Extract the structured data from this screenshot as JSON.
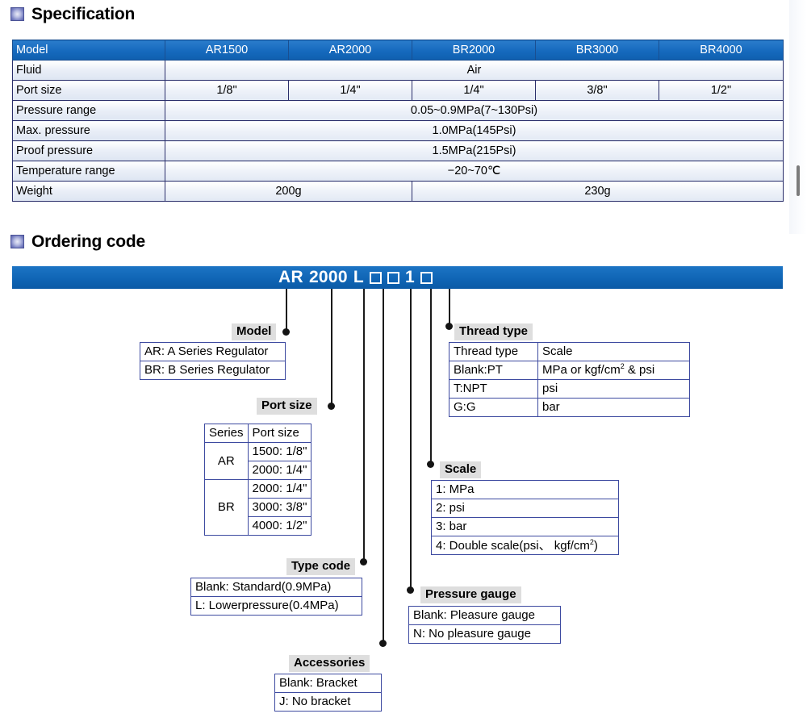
{
  "sections": {
    "specification": {
      "title": "Specification",
      "icon": "square-bullet-icon"
    },
    "ordering": {
      "title": "Ordering code",
      "icon": "square-bullet-icon"
    }
  },
  "spec_table": {
    "header": [
      "Model",
      "AR1500",
      "AR2000",
      "BR2000",
      "BR3000",
      "BR4000"
    ],
    "rows": [
      {
        "label": "Fluid",
        "cells": [
          {
            "text": "Air",
            "span": 5
          }
        ]
      },
      {
        "label": "Port size",
        "cells": [
          {
            "text": "1/8\"",
            "span": 1
          },
          {
            "text": "1/4\"",
            "span": 1
          },
          {
            "text": "1/4\"",
            "span": 1
          },
          {
            "text": "3/8\"",
            "span": 1
          },
          {
            "text": "1/2\"",
            "span": 1
          }
        ]
      },
      {
        "label": "Pressure range",
        "cells": [
          {
            "text": "0.05~0.9MPa(7~130Psi)",
            "span": 5
          }
        ]
      },
      {
        "label": "Max. pressure",
        "cells": [
          {
            "text": "1.0MPa(145Psi)",
            "span": 5
          }
        ]
      },
      {
        "label": "Proof pressure",
        "cells": [
          {
            "text": "1.5MPa(215Psi)",
            "span": 5
          }
        ]
      },
      {
        "label": "Temperature range",
        "cells": [
          {
            "text": "−20~70℃",
            "span": 5
          }
        ]
      },
      {
        "label": "Weight",
        "cells": [
          {
            "text": "200g",
            "span": 2
          },
          {
            "text": "230g",
            "span": 3
          }
        ]
      }
    ]
  },
  "ordering_code": {
    "parts": [
      "AR",
      "2000",
      "L"
    ],
    "box1": "",
    "box2": "",
    "digit": "1",
    "box3": ""
  },
  "callouts": {
    "model": {
      "label": "Model",
      "rows": [
        "AR: A Series Regulator",
        "BR: B Series Regulator"
      ]
    },
    "port_size": {
      "label": "Port size",
      "header": [
        "Series",
        "Port size"
      ],
      "groups": [
        {
          "series": "AR",
          "sizes": [
            "1500: 1/8\"",
            "2000: 1/4\""
          ]
        },
        {
          "series": "BR",
          "sizes": [
            "2000: 1/4\"",
            "3000: 3/8\"",
            "4000: 1/2\""
          ]
        }
      ]
    },
    "type_code": {
      "label": "Type code",
      "rows": [
        "Blank: Standard(0.9MPa)",
        "L: Lowerpressure(0.4MPa)"
      ]
    },
    "accessories": {
      "label": "Accessories",
      "rows": [
        "Blank: Bracket",
        "J: No bracket"
      ]
    },
    "thread_type": {
      "label": "Thread type",
      "header": [
        "Thread type",
        "Scale"
      ],
      "rows": [
        {
          "type": "Blank:PT",
          "scale_pre": "MPa or  kgf/cm",
          "scale_sup": "2",
          "scale_post": " & psi"
        },
        {
          "type": "T:NPT",
          "scale_pre": "psi",
          "scale_sup": "",
          "scale_post": ""
        },
        {
          "type": "G:G",
          "scale_pre": "bar",
          "scale_sup": "",
          "scale_post": ""
        }
      ]
    },
    "scale": {
      "label": "Scale",
      "rows": [
        {
          "pre": "1: MPa",
          "sup": "",
          "post": ""
        },
        {
          "pre": "2: psi",
          "sup": "",
          "post": ""
        },
        {
          "pre": "3: bar",
          "sup": "",
          "post": ""
        },
        {
          "pre": "4: Double scale(psi、 kgf/cm",
          "sup": "2",
          "post": ")"
        }
      ]
    },
    "pressure_gauge": {
      "label": "Pressure gauge",
      "rows": [
        "Blank: Pleasure gauge",
        "N: No pleasure gauge"
      ]
    }
  },
  "colors": {
    "header_blue": "#1569bd",
    "banner_blue": "#0f64b4",
    "border_navy": "#2b2f6b",
    "callout_border": "#3d4aa0",
    "label_bg": "#dedede"
  }
}
